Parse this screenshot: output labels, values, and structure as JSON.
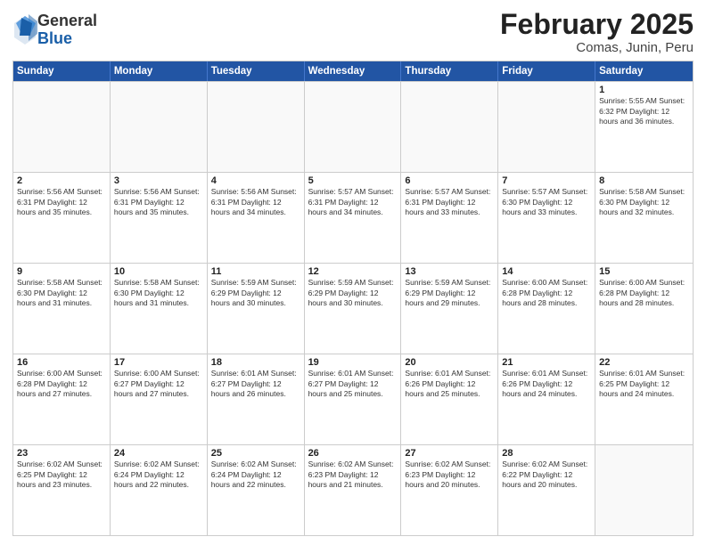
{
  "header": {
    "logo": {
      "general": "General",
      "blue": "Blue"
    },
    "title": "February 2025",
    "location": "Comas, Junin, Peru"
  },
  "weekdays": [
    "Sunday",
    "Monday",
    "Tuesday",
    "Wednesday",
    "Thursday",
    "Friday",
    "Saturday"
  ],
  "weeks": [
    [
      {
        "day": "",
        "info": ""
      },
      {
        "day": "",
        "info": ""
      },
      {
        "day": "",
        "info": ""
      },
      {
        "day": "",
        "info": ""
      },
      {
        "day": "",
        "info": ""
      },
      {
        "day": "",
        "info": ""
      },
      {
        "day": "1",
        "info": "Sunrise: 5:55 AM\nSunset: 6:32 PM\nDaylight: 12 hours and 36 minutes."
      }
    ],
    [
      {
        "day": "2",
        "info": "Sunrise: 5:56 AM\nSunset: 6:31 PM\nDaylight: 12 hours and 35 minutes."
      },
      {
        "day": "3",
        "info": "Sunrise: 5:56 AM\nSunset: 6:31 PM\nDaylight: 12 hours and 35 minutes."
      },
      {
        "day": "4",
        "info": "Sunrise: 5:56 AM\nSunset: 6:31 PM\nDaylight: 12 hours and 34 minutes."
      },
      {
        "day": "5",
        "info": "Sunrise: 5:57 AM\nSunset: 6:31 PM\nDaylight: 12 hours and 34 minutes."
      },
      {
        "day": "6",
        "info": "Sunrise: 5:57 AM\nSunset: 6:31 PM\nDaylight: 12 hours and 33 minutes."
      },
      {
        "day": "7",
        "info": "Sunrise: 5:57 AM\nSunset: 6:30 PM\nDaylight: 12 hours and 33 minutes."
      },
      {
        "day": "8",
        "info": "Sunrise: 5:58 AM\nSunset: 6:30 PM\nDaylight: 12 hours and 32 minutes."
      }
    ],
    [
      {
        "day": "9",
        "info": "Sunrise: 5:58 AM\nSunset: 6:30 PM\nDaylight: 12 hours and 31 minutes."
      },
      {
        "day": "10",
        "info": "Sunrise: 5:58 AM\nSunset: 6:30 PM\nDaylight: 12 hours and 31 minutes."
      },
      {
        "day": "11",
        "info": "Sunrise: 5:59 AM\nSunset: 6:29 PM\nDaylight: 12 hours and 30 minutes."
      },
      {
        "day": "12",
        "info": "Sunrise: 5:59 AM\nSunset: 6:29 PM\nDaylight: 12 hours and 30 minutes."
      },
      {
        "day": "13",
        "info": "Sunrise: 5:59 AM\nSunset: 6:29 PM\nDaylight: 12 hours and 29 minutes."
      },
      {
        "day": "14",
        "info": "Sunrise: 6:00 AM\nSunset: 6:28 PM\nDaylight: 12 hours and 28 minutes."
      },
      {
        "day": "15",
        "info": "Sunrise: 6:00 AM\nSunset: 6:28 PM\nDaylight: 12 hours and 28 minutes."
      }
    ],
    [
      {
        "day": "16",
        "info": "Sunrise: 6:00 AM\nSunset: 6:28 PM\nDaylight: 12 hours and 27 minutes."
      },
      {
        "day": "17",
        "info": "Sunrise: 6:00 AM\nSunset: 6:27 PM\nDaylight: 12 hours and 27 minutes."
      },
      {
        "day": "18",
        "info": "Sunrise: 6:01 AM\nSunset: 6:27 PM\nDaylight: 12 hours and 26 minutes."
      },
      {
        "day": "19",
        "info": "Sunrise: 6:01 AM\nSunset: 6:27 PM\nDaylight: 12 hours and 25 minutes."
      },
      {
        "day": "20",
        "info": "Sunrise: 6:01 AM\nSunset: 6:26 PM\nDaylight: 12 hours and 25 minutes."
      },
      {
        "day": "21",
        "info": "Sunrise: 6:01 AM\nSunset: 6:26 PM\nDaylight: 12 hours and 24 minutes."
      },
      {
        "day": "22",
        "info": "Sunrise: 6:01 AM\nSunset: 6:25 PM\nDaylight: 12 hours and 24 minutes."
      }
    ],
    [
      {
        "day": "23",
        "info": "Sunrise: 6:02 AM\nSunset: 6:25 PM\nDaylight: 12 hours and 23 minutes."
      },
      {
        "day": "24",
        "info": "Sunrise: 6:02 AM\nSunset: 6:24 PM\nDaylight: 12 hours and 22 minutes."
      },
      {
        "day": "25",
        "info": "Sunrise: 6:02 AM\nSunset: 6:24 PM\nDaylight: 12 hours and 22 minutes."
      },
      {
        "day": "26",
        "info": "Sunrise: 6:02 AM\nSunset: 6:23 PM\nDaylight: 12 hours and 21 minutes."
      },
      {
        "day": "27",
        "info": "Sunrise: 6:02 AM\nSunset: 6:23 PM\nDaylight: 12 hours and 20 minutes."
      },
      {
        "day": "28",
        "info": "Sunrise: 6:02 AM\nSunset: 6:22 PM\nDaylight: 12 hours and 20 minutes."
      },
      {
        "day": "",
        "info": ""
      }
    ]
  ]
}
